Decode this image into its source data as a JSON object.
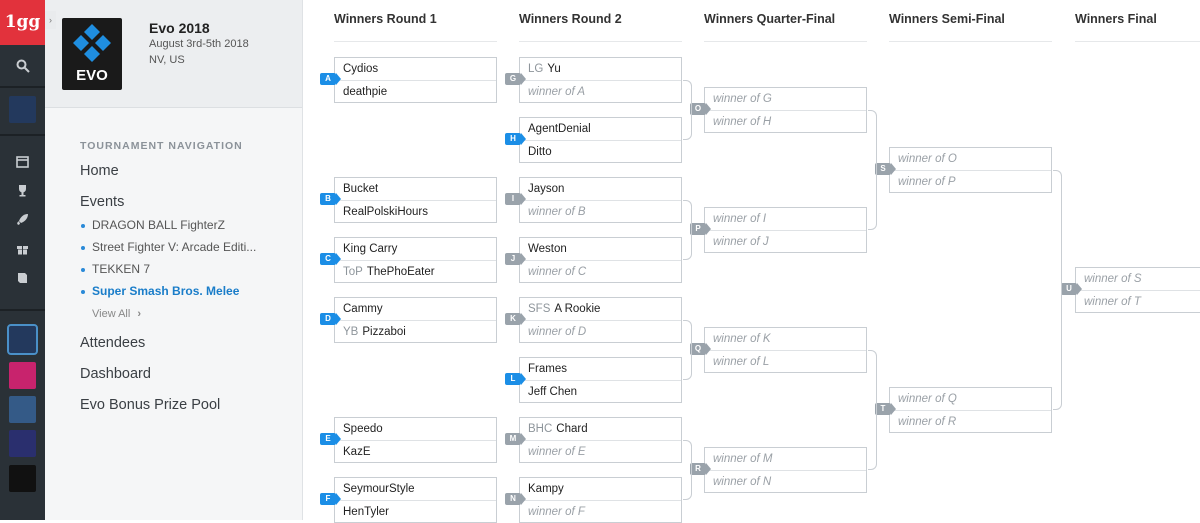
{
  "rail": {
    "logo_text": "1gg",
    "icons": [
      "search-icon",
      "evo-thumb",
      "calendar-icon",
      "trophy-icon",
      "rocket-icon",
      "gift-icon",
      "book-icon"
    ],
    "games": [
      {
        "name": "evo-tile",
        "color": "#23395d"
      },
      {
        "name": "pink-tile",
        "color": "#c8236d"
      },
      {
        "name": "ceo-tile",
        "color": "#345a87"
      },
      {
        "name": "pu-tile",
        "color": "#2a2f6e"
      },
      {
        "name": "optic-tile",
        "color": "#111111"
      }
    ]
  },
  "tournament": {
    "name": "Evo 2018",
    "date": "August 3rd-5th 2018",
    "location": "NV, US"
  },
  "nav": {
    "heading": "TOURNAMENT NAVIGATION",
    "home": "Home",
    "events": "Events",
    "event_items": [
      "DRAGON BALL FighterZ",
      "Street Fighter V: Arcade Editi...",
      "TEKKEN 7",
      "Super Smash Bros. Melee"
    ],
    "view_all": "View All",
    "attendees": "Attendees",
    "dashboard": "Dashboard",
    "prize_pool": "Evo Bonus Prize Pool"
  },
  "rounds": [
    "Winners Round 1",
    "Winners Round 2",
    "Winners Quarter-Final",
    "Winners Semi-Final",
    "Winners Final"
  ],
  "bracket": {
    "r1": [
      {
        "id": "A",
        "p1": "Cydios",
        "p2": "deathpie"
      },
      {
        "id": "B",
        "p1": "Bucket",
        "p2": "RealPolskiHours"
      },
      {
        "id": "C",
        "p1": "King Carry",
        "p2_prefix": "ToP",
        "p2": "ThePhoEater"
      },
      {
        "id": "D",
        "p1": "Cammy",
        "p2_prefix": "YB",
        "p2": "Pizzaboi"
      },
      {
        "id": "E",
        "p1": "Speedo",
        "p2": "KazE"
      },
      {
        "id": "F",
        "p1": "SeymourStyle",
        "p2": "HenTyler"
      }
    ],
    "r2": [
      {
        "id": "G",
        "p1_prefix": "LG",
        "p1": "Yu",
        "p2": "winner of A"
      },
      {
        "id": "H",
        "p1": "AgentDenial",
        "p2": "Ditto"
      },
      {
        "id": "I",
        "p1": "Jayson",
        "p2": "winner of B"
      },
      {
        "id": "J",
        "p1": "Weston",
        "p2": "winner of C"
      },
      {
        "id": "K",
        "p1_prefix": "SFS",
        "p1": "A Rookie",
        "p2": "winner of D"
      },
      {
        "id": "L",
        "p1": "Frames",
        "p2": "Jeff Chen"
      },
      {
        "id": "M",
        "p1_prefix": "BHC",
        "p1": "Chard",
        "p2": "winner of E"
      },
      {
        "id": "N",
        "p1": "Kampy",
        "p2": "winner of F"
      }
    ],
    "qf": [
      {
        "id": "O",
        "p1": "winner of G",
        "p2": "winner of H"
      },
      {
        "id": "P",
        "p1": "winner of I",
        "p2": "winner of J"
      },
      {
        "id": "Q",
        "p1": "winner of K",
        "p2": "winner of L"
      },
      {
        "id": "R",
        "p1": "winner of M",
        "p2": "winner of N"
      }
    ],
    "sf": [
      {
        "id": "S",
        "p1": "winner of O",
        "p2": "winner of P"
      },
      {
        "id": "T",
        "p1": "winner of Q",
        "p2": "winner of R"
      }
    ],
    "final": [
      {
        "id": "U",
        "p1": "winner of S",
        "p2": "winner of T"
      }
    ]
  },
  "colors": {
    "tag_blue": "#1b8ee6",
    "tag_gray": "#9aa3ab",
    "accent": "#1a7dc9",
    "rail": "#2a3137",
    "logo_red": "#e2323c"
  }
}
